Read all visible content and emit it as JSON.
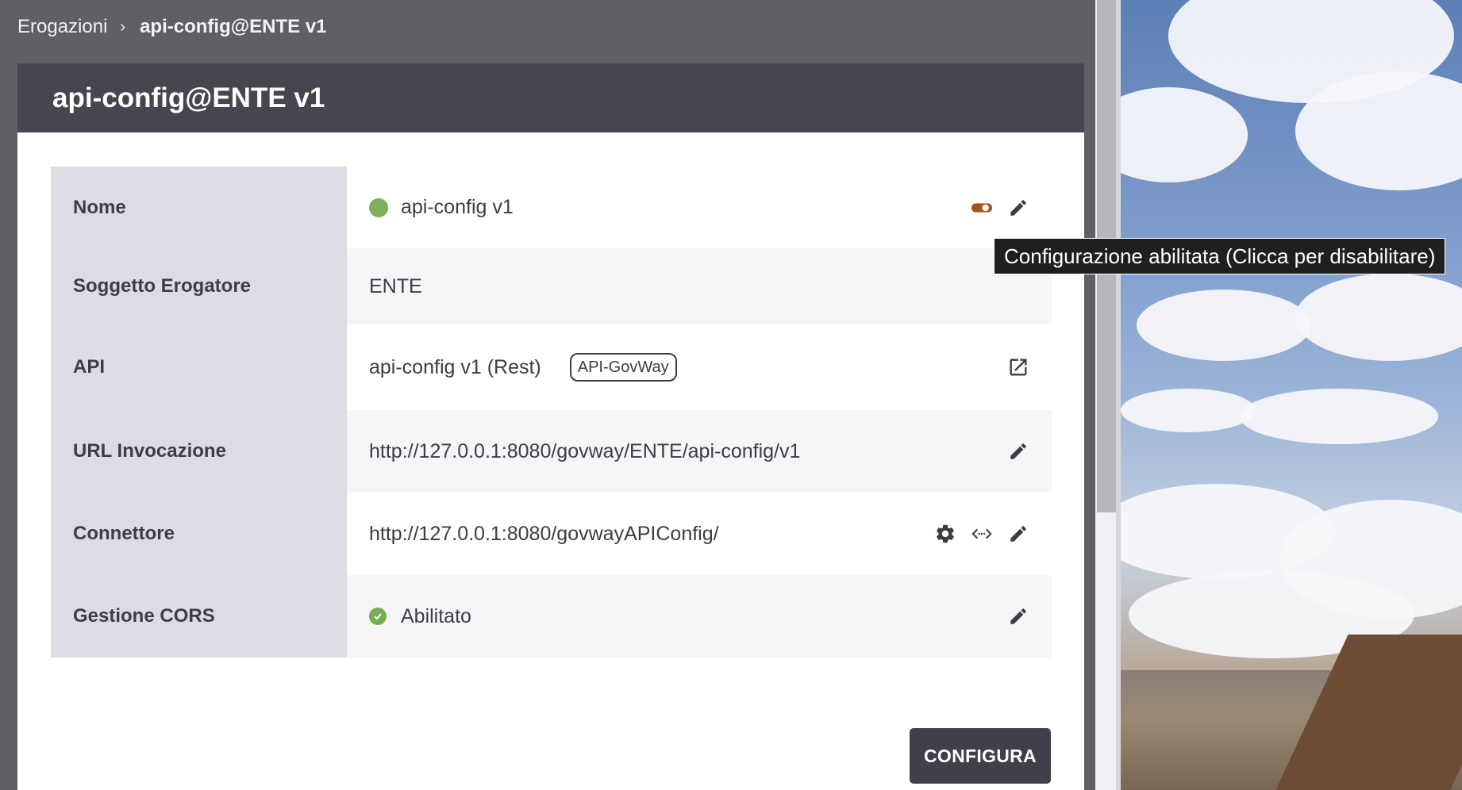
{
  "breadcrumb": {
    "parent": "Erogazioni",
    "separator": "›",
    "current": "api-config@ENTE v1"
  },
  "card": {
    "title": "api-config@ENTE v1"
  },
  "rows": {
    "nome": {
      "label": "Nome",
      "value": "api-config v1",
      "status_color": "#7bb15b",
      "toggle_color": "#a5521e",
      "icons": [
        "toggle-icon",
        "pencil-icon"
      ]
    },
    "soggetto": {
      "label": "Soggetto Erogatore",
      "value": "ENTE"
    },
    "api": {
      "label": "API",
      "value": "api-config v1 (Rest)",
      "badge": "API-GovWay",
      "icons": [
        "open-external-icon"
      ]
    },
    "url": {
      "label": "URL Invocazione",
      "value": "http://127.0.0.1:8080/govway/ENTE/api-config/v1",
      "icons": [
        "pencil-icon"
      ]
    },
    "connettore": {
      "label": "Connettore",
      "value": "http://127.0.0.1:8080/govwayAPIConfig/",
      "icons": [
        "gear-icon",
        "code-arrows-icon",
        "pencil-icon"
      ]
    },
    "cors": {
      "label": "Gestione CORS",
      "value": "Abilitato",
      "status_color": "#74b04f",
      "icons": [
        "pencil-icon"
      ]
    }
  },
  "actions": {
    "configure_label": "CONFIGURA"
  },
  "tooltip": {
    "text": "Configurazione abilitata (Clicca per disabilitare)"
  }
}
